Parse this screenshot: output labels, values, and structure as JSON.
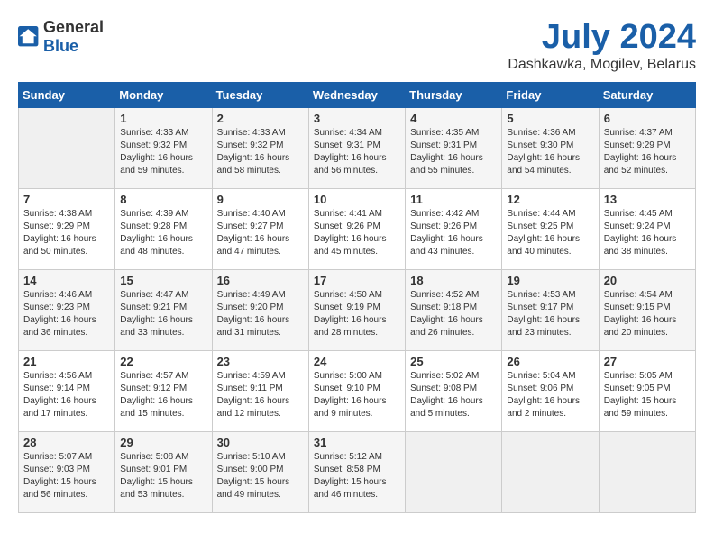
{
  "header": {
    "logo_general": "General",
    "logo_blue": "Blue",
    "title": "July 2024",
    "subtitle": "Dashkawka, Mogilev, Belarus"
  },
  "calendar": {
    "columns": [
      "Sunday",
      "Monday",
      "Tuesday",
      "Wednesday",
      "Thursday",
      "Friday",
      "Saturday"
    ],
    "weeks": [
      [
        {
          "day": "",
          "info": ""
        },
        {
          "day": "1",
          "info": "Sunrise: 4:33 AM\nSunset: 9:32 PM\nDaylight: 16 hours\nand 59 minutes."
        },
        {
          "day": "2",
          "info": "Sunrise: 4:33 AM\nSunset: 9:32 PM\nDaylight: 16 hours\nand 58 minutes."
        },
        {
          "day": "3",
          "info": "Sunrise: 4:34 AM\nSunset: 9:31 PM\nDaylight: 16 hours\nand 56 minutes."
        },
        {
          "day": "4",
          "info": "Sunrise: 4:35 AM\nSunset: 9:31 PM\nDaylight: 16 hours\nand 55 minutes."
        },
        {
          "day": "5",
          "info": "Sunrise: 4:36 AM\nSunset: 9:30 PM\nDaylight: 16 hours\nand 54 minutes."
        },
        {
          "day": "6",
          "info": "Sunrise: 4:37 AM\nSunset: 9:29 PM\nDaylight: 16 hours\nand 52 minutes."
        }
      ],
      [
        {
          "day": "7",
          "info": "Sunrise: 4:38 AM\nSunset: 9:29 PM\nDaylight: 16 hours\nand 50 minutes."
        },
        {
          "day": "8",
          "info": "Sunrise: 4:39 AM\nSunset: 9:28 PM\nDaylight: 16 hours\nand 48 minutes."
        },
        {
          "day": "9",
          "info": "Sunrise: 4:40 AM\nSunset: 9:27 PM\nDaylight: 16 hours\nand 47 minutes."
        },
        {
          "day": "10",
          "info": "Sunrise: 4:41 AM\nSunset: 9:26 PM\nDaylight: 16 hours\nand 45 minutes."
        },
        {
          "day": "11",
          "info": "Sunrise: 4:42 AM\nSunset: 9:26 PM\nDaylight: 16 hours\nand 43 minutes."
        },
        {
          "day": "12",
          "info": "Sunrise: 4:44 AM\nSunset: 9:25 PM\nDaylight: 16 hours\nand 40 minutes."
        },
        {
          "day": "13",
          "info": "Sunrise: 4:45 AM\nSunset: 9:24 PM\nDaylight: 16 hours\nand 38 minutes."
        }
      ],
      [
        {
          "day": "14",
          "info": "Sunrise: 4:46 AM\nSunset: 9:23 PM\nDaylight: 16 hours\nand 36 minutes."
        },
        {
          "day": "15",
          "info": "Sunrise: 4:47 AM\nSunset: 9:21 PM\nDaylight: 16 hours\nand 33 minutes."
        },
        {
          "day": "16",
          "info": "Sunrise: 4:49 AM\nSunset: 9:20 PM\nDaylight: 16 hours\nand 31 minutes."
        },
        {
          "day": "17",
          "info": "Sunrise: 4:50 AM\nSunset: 9:19 PM\nDaylight: 16 hours\nand 28 minutes."
        },
        {
          "day": "18",
          "info": "Sunrise: 4:52 AM\nSunset: 9:18 PM\nDaylight: 16 hours\nand 26 minutes."
        },
        {
          "day": "19",
          "info": "Sunrise: 4:53 AM\nSunset: 9:17 PM\nDaylight: 16 hours\nand 23 minutes."
        },
        {
          "day": "20",
          "info": "Sunrise: 4:54 AM\nSunset: 9:15 PM\nDaylight: 16 hours\nand 20 minutes."
        }
      ],
      [
        {
          "day": "21",
          "info": "Sunrise: 4:56 AM\nSunset: 9:14 PM\nDaylight: 16 hours\nand 17 minutes."
        },
        {
          "day": "22",
          "info": "Sunrise: 4:57 AM\nSunset: 9:12 PM\nDaylight: 16 hours\nand 15 minutes."
        },
        {
          "day": "23",
          "info": "Sunrise: 4:59 AM\nSunset: 9:11 PM\nDaylight: 16 hours\nand 12 minutes."
        },
        {
          "day": "24",
          "info": "Sunrise: 5:00 AM\nSunset: 9:10 PM\nDaylight: 16 hours\nand 9 minutes."
        },
        {
          "day": "25",
          "info": "Sunrise: 5:02 AM\nSunset: 9:08 PM\nDaylight: 16 hours\nand 5 minutes."
        },
        {
          "day": "26",
          "info": "Sunrise: 5:04 AM\nSunset: 9:06 PM\nDaylight: 16 hours\nand 2 minutes."
        },
        {
          "day": "27",
          "info": "Sunrise: 5:05 AM\nSunset: 9:05 PM\nDaylight: 15 hours\nand 59 minutes."
        }
      ],
      [
        {
          "day": "28",
          "info": "Sunrise: 5:07 AM\nSunset: 9:03 PM\nDaylight: 15 hours\nand 56 minutes."
        },
        {
          "day": "29",
          "info": "Sunrise: 5:08 AM\nSunset: 9:01 PM\nDaylight: 15 hours\nand 53 minutes."
        },
        {
          "day": "30",
          "info": "Sunrise: 5:10 AM\nSunset: 9:00 PM\nDaylight: 15 hours\nand 49 minutes."
        },
        {
          "day": "31",
          "info": "Sunrise: 5:12 AM\nSunset: 8:58 PM\nDaylight: 15 hours\nand 46 minutes."
        },
        {
          "day": "",
          "info": ""
        },
        {
          "day": "",
          "info": ""
        },
        {
          "day": "",
          "info": ""
        }
      ]
    ]
  }
}
